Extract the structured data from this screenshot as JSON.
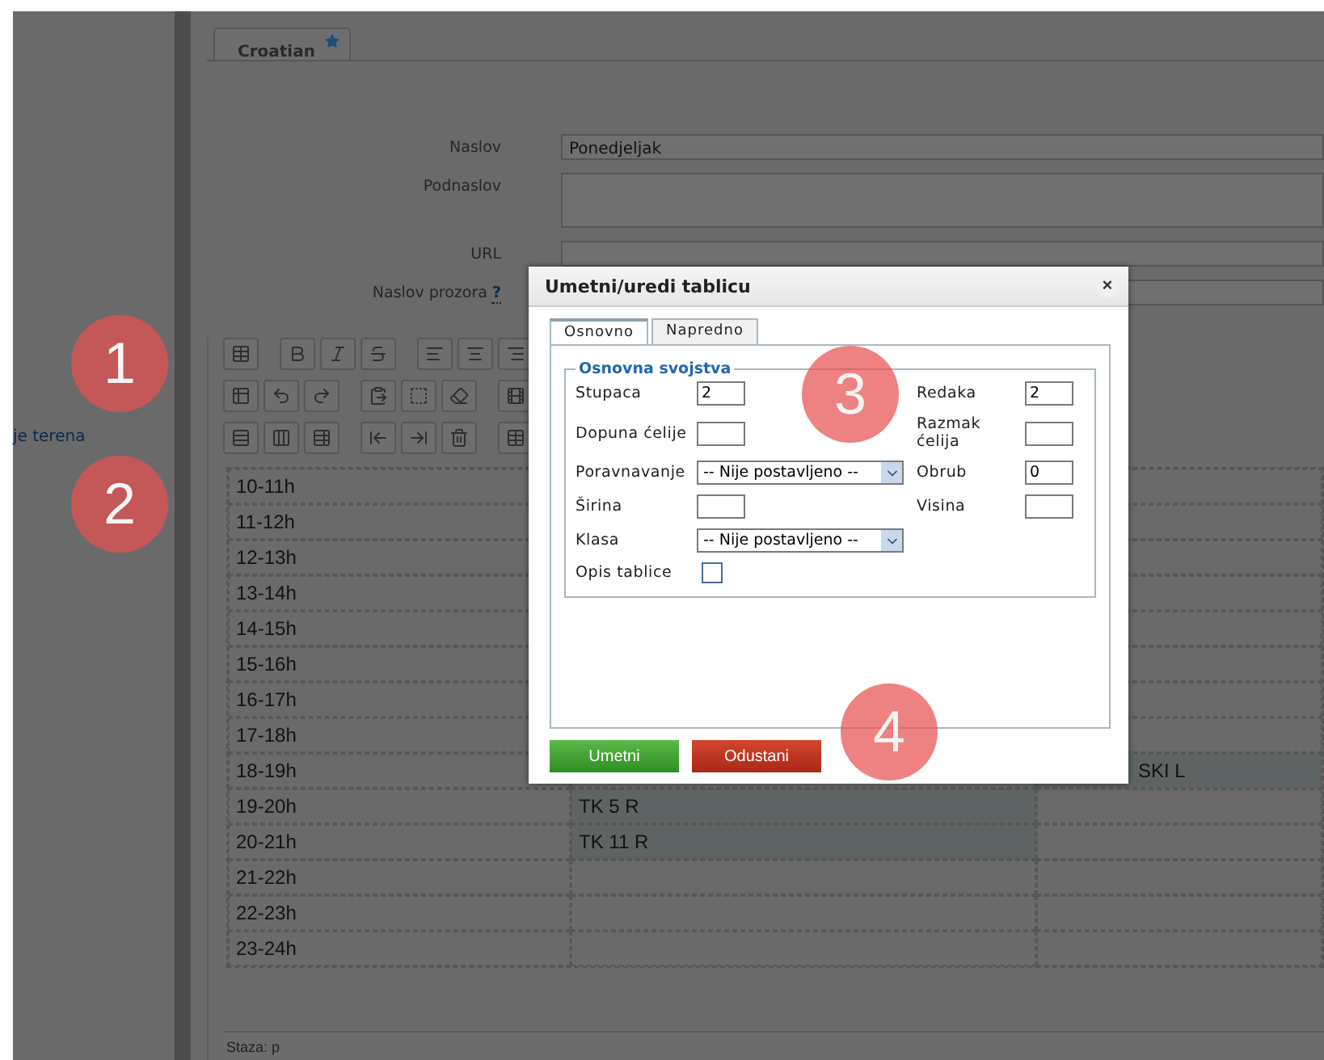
{
  "sidebar": {
    "link": "je terena"
  },
  "tabs": [
    {
      "label": "Croatian",
      "selected": true
    }
  ],
  "form": [
    {
      "kind": "input",
      "label": "Naslov",
      "value": "Ponedjeljak"
    },
    {
      "kind": "textarea",
      "label": "Podnaslov"
    },
    {
      "kind": "input",
      "label": "URL"
    },
    {
      "kind": "input",
      "label": "Naslov prozora",
      "help": "?"
    }
  ],
  "table": {
    "rows": [
      {
        "time": "10-11h"
      },
      {
        "time": "11-12h"
      },
      {
        "time": "12-13h"
      },
      {
        "time": "13-14h"
      },
      {
        "time": "14-15h"
      },
      {
        "time": "15-16h"
      },
      {
        "time": "16-17h"
      },
      {
        "time": "17-18h"
      },
      {
        "time": "18-19h",
        "column_3": {
          "text": "SKI L",
          "highlighted": true
        }
      },
      {
        "time": "19-20h",
        "column_2": {
          "text": "TK 5 R",
          "highlighted": true
        }
      },
      {
        "time": "20-21h",
        "column_2": {
          "text": "TK 11 R",
          "highlighted": true
        }
      },
      {
        "time": "21-22h"
      },
      {
        "time": "22-23h"
      },
      {
        "time": "23-24h"
      }
    ]
  },
  "status_bar": "Staza: p",
  "dialog": {
    "title": "Umetni/uredi tablicu",
    "close": "×",
    "tabs": [
      {
        "label": "Osnovno",
        "selected": true
      },
      {
        "label": "Napredno",
        "selected": false
      }
    ],
    "legend": "Osnovna svojstva",
    "rows": [
      {
        "left": {
          "kind": "input",
          "label": "Stupaca",
          "value": "2"
        },
        "right": {
          "kind": "input",
          "label": "Redaka",
          "value": "2"
        }
      },
      {
        "left": {
          "kind": "input",
          "label": "Dopuna ćelije"
        },
        "right": {
          "kind": "input",
          "label": "Razmak ćelija"
        }
      },
      {
        "left": {
          "kind": "select",
          "label": "Poravnavanje",
          "value": "-- Nije postavljeno --"
        },
        "right": {
          "kind": "input",
          "label": "Obrub",
          "value": "0"
        }
      },
      {
        "left": {
          "kind": "input",
          "label": "Širina"
        },
        "right": {
          "kind": "input",
          "label": "Visina"
        }
      },
      {
        "left": {
          "kind": "select",
          "label": "Klasa",
          "value": "-- Nije postavljeno --"
        }
      },
      {
        "left": {
          "kind": "checkbox",
          "label": "Opis tablice",
          "checked": false
        }
      }
    ],
    "buttons": [
      {
        "kind": "primary",
        "label": "Umetni"
      },
      {
        "kind": "cancel",
        "label": "Odustani"
      }
    ]
  },
  "annotations": [
    {
      "number": "1"
    },
    {
      "number": "2"
    },
    {
      "number": "3"
    },
    {
      "number": "4"
    }
  ]
}
